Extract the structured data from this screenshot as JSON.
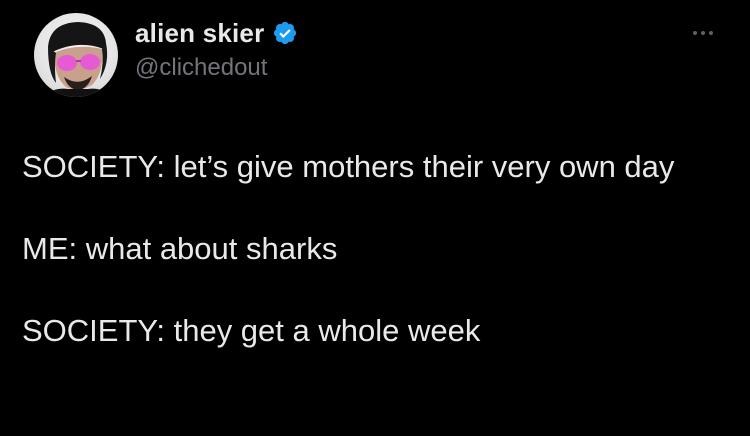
{
  "tweet": {
    "author": {
      "display_name": "alien skier",
      "handle": "@clichedout",
      "verified": true
    },
    "more_icon": "more-horizontal-icon",
    "paragraphs": [
      "SOCIETY:  let’s give mothers their very own day",
      "ME: what about sharks",
      "SOCIETY: they get a whole week"
    ]
  },
  "colors": {
    "background": "#000000",
    "text": "#e7e9ea",
    "secondary_text": "#71767b",
    "verified_badge": "#1d9bf0"
  }
}
